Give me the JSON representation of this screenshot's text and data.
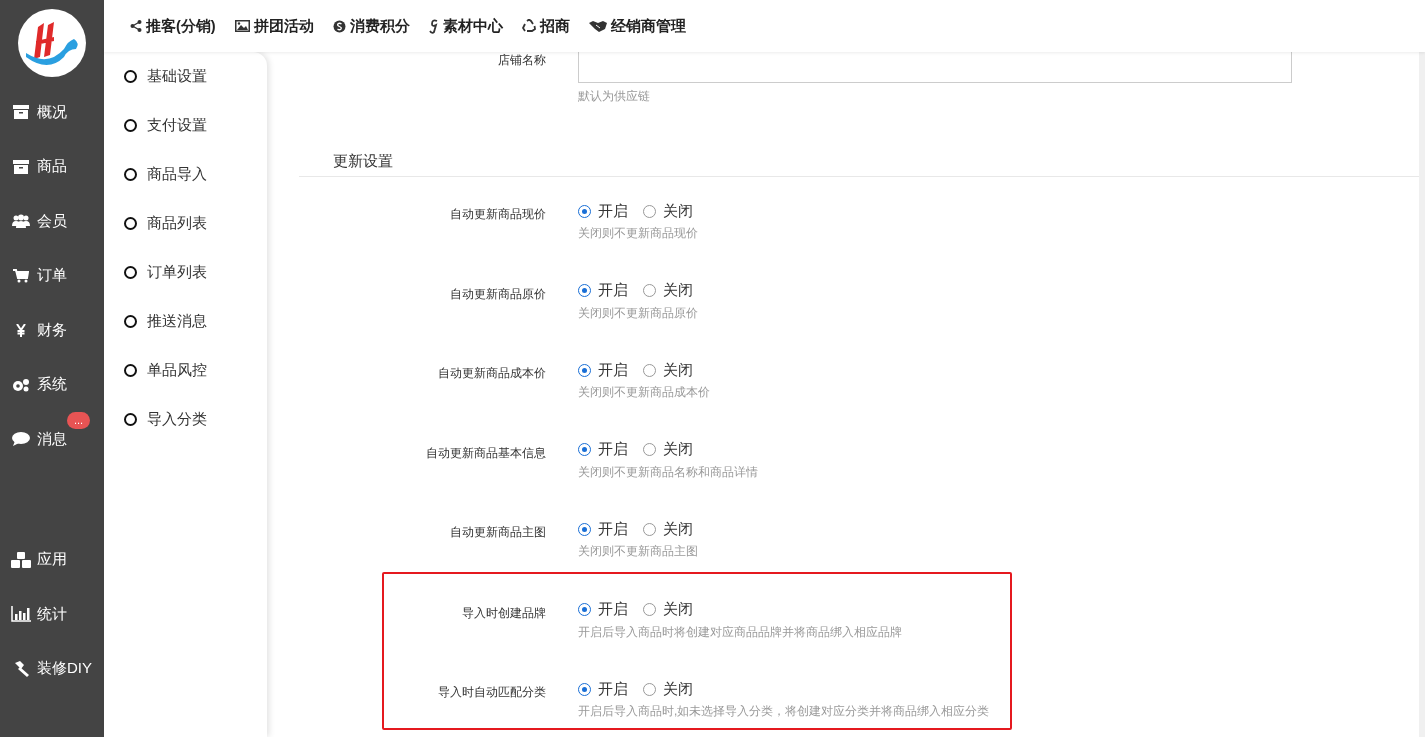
{
  "sidebar": {
    "items": [
      {
        "label": "概况"
      },
      {
        "label": "商品"
      },
      {
        "label": "会员"
      },
      {
        "label": "订单"
      },
      {
        "label": "财务"
      },
      {
        "label": "系统"
      },
      {
        "label": "消息",
        "badge": "..."
      }
    ],
    "bottom_items": [
      {
        "label": "应用"
      },
      {
        "label": "统计"
      },
      {
        "label": "装修DIY"
      }
    ]
  },
  "top_nav": [
    "推客(分销)",
    "拼团活动",
    "消费积分",
    "素材中心",
    "招商",
    "经销商管理"
  ],
  "sub_nav": [
    "基础设置",
    "支付设置",
    "商品导入",
    "商品列表",
    "订单列表",
    "推送消息",
    "单品风控",
    "导入分类"
  ],
  "shop_name": {
    "label": "店铺名称",
    "hint": "默认为供应链"
  },
  "section_title": "更新设置",
  "settings": [
    {
      "label": "自动更新商品现价",
      "options": [
        {
          "label": "开启",
          "selected": true
        },
        {
          "label": "关闭",
          "selected": false
        }
      ],
      "hint": "关闭则不更新商品现价"
    },
    {
      "label": "自动更新商品原价",
      "options": [
        {
          "label": "开启",
          "selected": true
        },
        {
          "label": "关闭",
          "selected": false
        }
      ],
      "hint": "关闭则不更新商品原价"
    },
    {
      "label": "自动更新商品成本价",
      "options": [
        {
          "label": "开启",
          "selected": true
        },
        {
          "label": "关闭",
          "selected": false
        }
      ],
      "hint": "关闭则不更新商品成本价"
    },
    {
      "label": "自动更新商品基本信息",
      "options": [
        {
          "label": "开启",
          "selected": true
        },
        {
          "label": "关闭",
          "selected": false
        }
      ],
      "hint": "关闭则不更新商品名称和商品详情"
    },
    {
      "label": "自动更新商品主图",
      "options": [
        {
          "label": "开启",
          "selected": true
        },
        {
          "label": "关闭",
          "selected": false
        }
      ],
      "hint": "关闭则不更新商品主图"
    }
  ],
  "highlighted_settings": [
    {
      "label": "导入时创建品牌",
      "options": [
        {
          "label": "开启",
          "selected": true
        },
        {
          "label": "关闭",
          "selected": false
        }
      ],
      "hint": "开启后导入商品时将创建对应商品品牌并将商品绑入相应品牌"
    },
    {
      "label": "导入时自动匹配分类",
      "options": [
        {
          "label": "开启",
          "selected": true
        },
        {
          "label": "关闭",
          "selected": false
        }
      ],
      "hint": "开启后导入商品时,如未选择导入分类，将创建对应分类并将商品绑入相应分类"
    }
  ]
}
